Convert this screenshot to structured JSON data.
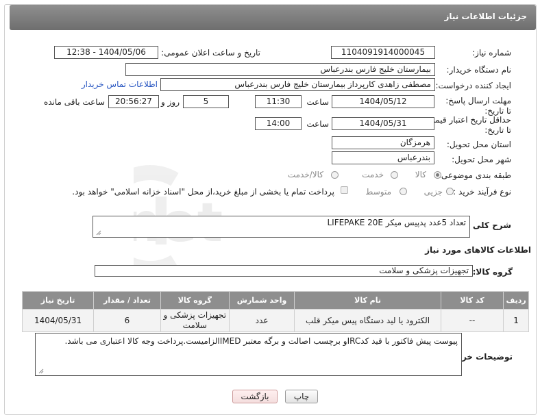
{
  "header": {
    "title": "جزئیات اطلاعات نیاز"
  },
  "fields": {
    "need_number_label": "شماره نیاز:",
    "need_number": "1104091914000045",
    "announce_label": "تاریخ و ساعت اعلان عمومی:",
    "announce_value": "1404/05/06 - 12:38",
    "buyer_org_label": "نام دستگاه خریدار:",
    "buyer_org": "بیمارستان خلیج فارس بندرعباس",
    "requester_label": "ایجاد کننده درخواست:",
    "requester": "مصطفی زاهدی کارپرداز بیمارستان خلیج فارس بندرعباس",
    "contact_link": "اطلاعات تماس خریدار",
    "reply_deadline_label": "مهلت ارسال پاسخ: تا تاریخ:",
    "reply_date": "1404/05/12",
    "time_label": "ساعت",
    "reply_time": "11:30",
    "days": "5",
    "days_label": "روز و",
    "remaining_time": "20:56:27",
    "remaining_label": "ساعت باقی مانده",
    "price_validity_label": "حداقل تاریخ اعتبار قیمت: تا تاریخ:",
    "price_date": "1404/05/31",
    "price_time": "14:00",
    "province_label": "استان محل تحویل:",
    "province": "هرمزگان",
    "city_label": "شهر محل تحویل:",
    "city": "بندرعباس",
    "category_label": "طبقه بندی موضوعی:",
    "category_options": [
      "کالا",
      "خدمت",
      "کالا/خدمت"
    ],
    "process_label": "نوع فرآیند خرید :",
    "process_options": [
      "جزیی",
      "متوسط"
    ],
    "payment_note": "پرداخت تمام یا بخشی از مبلغ خرید،از محل \"اسناد خزانه اسلامی\" خواهد بود."
  },
  "description": {
    "label": "شرح کلی نیاز:",
    "value": "تعداد 5عدد پدپیس میکر LIFEPAKE 20E"
  },
  "goods": {
    "section_title": "اطلاعات کالاهای مورد نیاز",
    "group_label": "گروه کالا:",
    "group_value": "تجهیزات پزشکی و سلامت",
    "columns": [
      "ردیف",
      "کد کالا",
      "نام کالا",
      "واحد شمارش",
      "گروه کالا",
      "تعداد / مقدار",
      "تاریخ نیاز"
    ],
    "rows": [
      [
        "1",
        "--",
        "الکترود یا لید دستگاه پیس میکر قلب",
        "عدد",
        "تجهیزات پزشکی و سلامت",
        "6",
        "1404/05/31"
      ]
    ]
  },
  "buyer_notes": {
    "label": "توضیحات خریدار:",
    "value": "پیوست پیش فاکتور با قید کدIRCو برچسب اصالت و برگه معتبر IMEDالزامیست.پرداخت وجه کالا اعتباری می باشد."
  },
  "buttons": {
    "print": "چاپ",
    "back": "بازگشت"
  },
  "watermark": {
    "text": "AriaTender.net"
  }
}
